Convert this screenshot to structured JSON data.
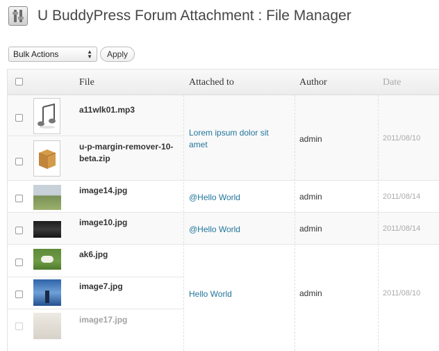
{
  "header": {
    "title": "U BuddyPress Forum Attachment : File Manager"
  },
  "bulk": {
    "select_label": "Bulk Actions",
    "apply_label": "Apply"
  },
  "columns": {
    "file": "File",
    "attached": "Attached to",
    "author": "Author",
    "date": "Date"
  },
  "rows": [
    {
      "file": "a11wlk01.mp3",
      "author": "admin",
      "date": "2011/08/10",
      "thumb_icon": "music-note-icon"
    },
    {
      "file": "u-p-margin-remover-10-beta.zip",
      "author": "admin",
      "date": "2011/08/10",
      "thumb_icon": "archive-box-icon"
    },
    {
      "file": "image14.jpg",
      "author": "admin",
      "date": "2011/08/14"
    },
    {
      "file": "image10.jpg",
      "author": "admin",
      "date": "2011/08/14"
    },
    {
      "file": "ak6.jpg",
      "author": "admin",
      "date": "2011/08/10"
    },
    {
      "file": "image7.jpg",
      "author": "admin",
      "date": "2011/08/10"
    },
    {
      "file": "image17.jpg",
      "author": "admin",
      "date": "2011/08/10"
    }
  ],
  "groups": [
    {
      "attached": "Lorem ipsum dolor sit amet",
      "author": "admin",
      "date": "2011/08/10"
    },
    {
      "attached": "@Hello World",
      "author": "admin",
      "date": "2011/08/14"
    },
    {
      "attached": "@Hello World",
      "author": "admin",
      "date": "2011/08/14"
    },
    {
      "attached": "Hello World",
      "author": "admin",
      "date": "2011/08/10"
    }
  ],
  "colors": {
    "link": "#21759b",
    "header_bg": "#ececec",
    "alt_row": "#f9f9f9"
  }
}
